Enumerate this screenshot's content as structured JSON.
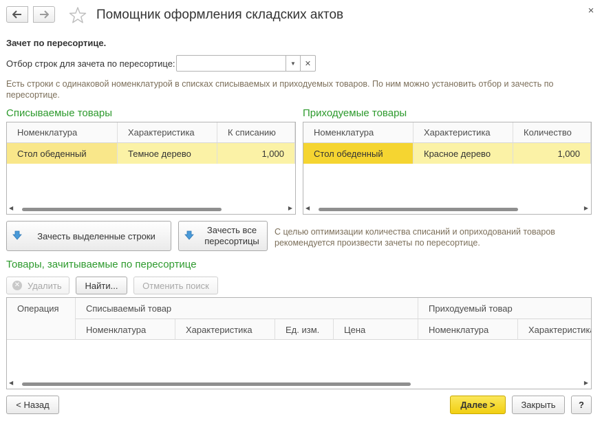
{
  "window": {
    "title": "Помощник оформления складских актов",
    "close_symbol": "×"
  },
  "icons": {
    "back": "arrow-left-icon",
    "forward": "arrow-right-icon",
    "favorite": "star-icon",
    "close": "close-icon",
    "dropdown": "chevron-down-icon",
    "clear": "clear-icon",
    "move": "arrow-down-icon",
    "delete": "delete-icon"
  },
  "colors": {
    "green_title": "#2d9a2d",
    "hint_text": "#7c6f5a",
    "selected_row": "#fbf2a6",
    "selected_cell_active": "#f5d531",
    "primary_button": "#f1cf12"
  },
  "form": {
    "section_title": "Зачет по пересортице.",
    "filter_label": "Отбор строк для зачета по пересортице:",
    "filter_value": "",
    "info": "Есть строки с одинаковой номенклатурой в списках списываемых и приходуемых товаров. По ним можно установить отбор и зачесть по пересортице."
  },
  "writeoff": {
    "title": "Списываемые товары",
    "columns": [
      "Номенклатура",
      "Характеристика",
      "К списанию"
    ],
    "rows": [
      {
        "item": "Стол обеденный",
        "characteristic": "Темное дерево",
        "qty": "1,000"
      }
    ]
  },
  "receipt": {
    "title": "Приходуемые товары",
    "columns": [
      "Номенклатура",
      "Характеристика",
      "Количество"
    ],
    "rows": [
      {
        "item": "Стол обеденный",
        "characteristic": "Красное дерево",
        "qty": "1,000"
      }
    ]
  },
  "actions": {
    "offset_selected": "Зачесть выделенные строки",
    "offset_all": "Зачесть все пересортицы",
    "hint": "С целью оптимизации количества списаний и оприходований товаров рекомендуется произвести зачеты по пересортице."
  },
  "offset_section": {
    "title": "Товары, зачитываемые по пересортице",
    "toolbar": {
      "delete": "Удалить",
      "find": "Найти...",
      "cancel_search": "Отменить поиск"
    },
    "columns": {
      "operation": "Операция",
      "writeoff_group": "Списываемый товар",
      "receipt_group": "Приходуемый товар",
      "writeoff_item": "Номенклатура",
      "writeoff_characteristic": "Характеристика",
      "unit": "Ед. изм.",
      "price": "Цена",
      "receipt_item": "Номенклатура",
      "receipt_characteristic": "Характеристика"
    }
  },
  "footer": {
    "back": "< Назад",
    "next": "Далее >",
    "close": "Закрыть",
    "help": "?"
  }
}
